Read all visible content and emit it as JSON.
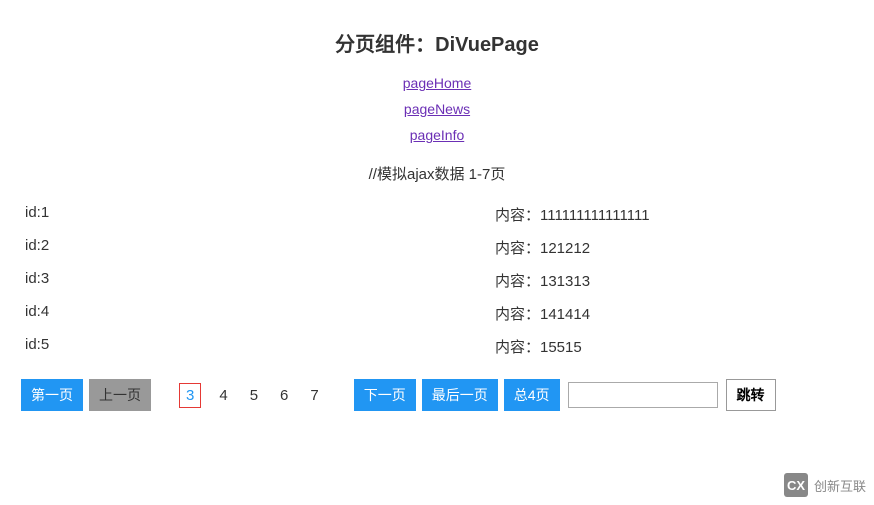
{
  "title": "分页组件：DiVuePage",
  "links": [
    {
      "label": "pageHome"
    },
    {
      "label": "pageNews"
    },
    {
      "label": "pageInfo"
    }
  ],
  "ajax_note": "//模拟ajax数据 1-7页",
  "data_rows": [
    {
      "id": "id:1",
      "content": "内容：111111111111111"
    },
    {
      "id": "id:2",
      "content": "内容：121212"
    },
    {
      "id": "id:3",
      "content": "内容：131313"
    },
    {
      "id": "id:4",
      "content": "内容：141414"
    },
    {
      "id": "id:5",
      "content": "内容：15515"
    }
  ],
  "pagination": {
    "first": "第一页",
    "prev": "上一页",
    "next": "下一页",
    "last": "最后一页",
    "total": "总4页",
    "jump": "跳转",
    "pages": [
      "3",
      "4",
      "5",
      "6",
      "7"
    ],
    "active_index": 0,
    "input_value": ""
  },
  "watermark": {
    "icon": "CX",
    "text": "创新互联"
  }
}
